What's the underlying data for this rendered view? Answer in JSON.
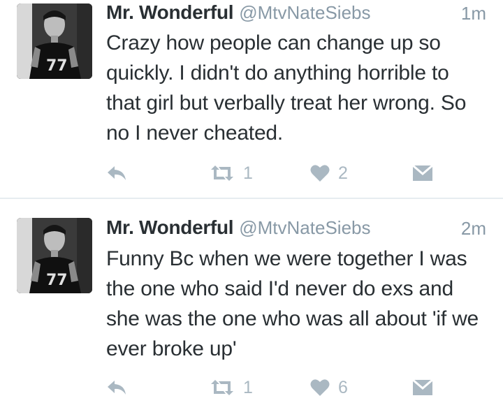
{
  "tweets": [
    {
      "user": {
        "name": "Mr. Wonderful",
        "handle": "@MtvNateSiebs"
      },
      "time": "1m",
      "text": "Crazy how people can change up so quickly. I didn't do anything horrible to that girl but verbally treat her wrong. So no I never cheated.",
      "retweets": "1",
      "likes": "2"
    },
    {
      "user": {
        "name": "Mr. Wonderful",
        "handle": "@MtvNateSiebs"
      },
      "time": "2m",
      "text": "Funny Bc when we were together I was the one who said I'd never do exs and she was the one who was all about 'if we ever broke up'",
      "retweets": "1",
      "likes": "6"
    }
  ],
  "icons": {
    "reply": "reply-icon",
    "retweet": "retweet-icon",
    "like": "heart-icon",
    "dm": "envelope-icon"
  },
  "colors": {
    "text": "#292f33",
    "muted": "#8899a6",
    "action": "#aab8c2",
    "divider": "#e6ecf0"
  }
}
